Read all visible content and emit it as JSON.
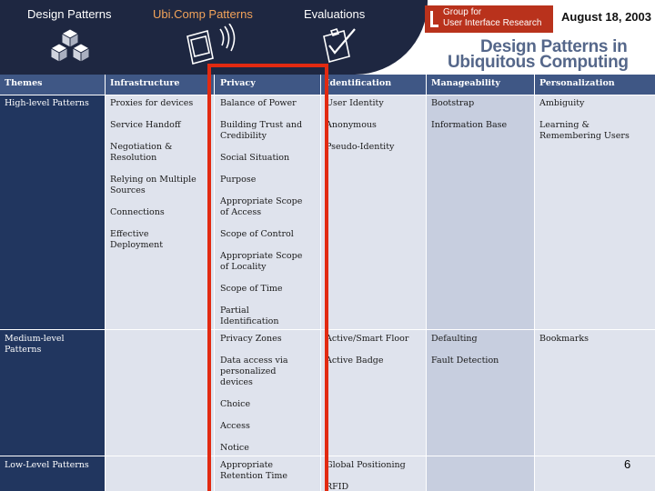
{
  "nav": {
    "design_patterns": "Design Patterns",
    "ubicomp_patterns": "Ubi.Comp Patterns",
    "evaluations": "Evaluations"
  },
  "logo": {
    "line1": "Group for",
    "line2": "User Interface Research"
  },
  "date": "August 18, 2003",
  "title": {
    "line1": "Design Patterns in",
    "line2": "Ubiquitous Computing"
  },
  "colors": {
    "header_dark": "#1e2741",
    "row_label_bg": "#21365f",
    "header_row_bg": "#3f5785",
    "col_light": "#dfe3ed",
    "col_mid": "#c7cedf",
    "highlight": "#e22a11",
    "logo_red": "#b9321c",
    "title": "#55678a",
    "accent_nav": "#f2a35a"
  },
  "icons": [
    "cubes-icon",
    "pda-icon",
    "clipboard-check-icon"
  ],
  "table": {
    "columns": [
      "Themes",
      "Infrastructure",
      "Privacy",
      "Identification",
      "Manageability",
      "Personalization"
    ],
    "rows": [
      {
        "label": "High-level Patterns",
        "infrastructure": [
          "Proxies for devices",
          "Service Handoff",
          "Negotiation & Resolution",
          "Relying on Multiple Sources",
          "Connections",
          "Effective Deployment"
        ],
        "privacy": [
          "Balance of Power",
          "Building Trust and Credibility",
          "Social Situation",
          "Purpose",
          "Appropriate Scope of Access",
          "Scope of Control",
          "Appropriate Scope of Locality",
          "Scope of Time",
          "Partial Identification"
        ],
        "identification": [
          "User Identity",
          "Anonymous",
          "Pseudo-Identity"
        ],
        "manageability": [
          "Bootstrap",
          "Information Base"
        ],
        "personalization": [
          "Ambiguity",
          "Learning & Remembering Users"
        ]
      },
      {
        "label": "Medium-level Patterns",
        "infrastructure": [],
        "privacy": [
          "Privacy Zones",
          "Data access via personalized devices",
          "Choice",
          "Access",
          "Notice"
        ],
        "identification": [
          "Active/Smart Floor",
          "Active Badge"
        ],
        "manageability": [
          "Defaulting",
          "Fault Detection"
        ],
        "personalization": [
          "Bookmarks"
        ]
      },
      {
        "label": "Low-Level Patterns",
        "infrastructure": [],
        "privacy": [
          "Appropriate Retention Time"
        ],
        "identification": [
          "Global Positioning",
          "RFID"
        ],
        "manageability": [],
        "personalization": []
      }
    ]
  },
  "page_number": "6"
}
